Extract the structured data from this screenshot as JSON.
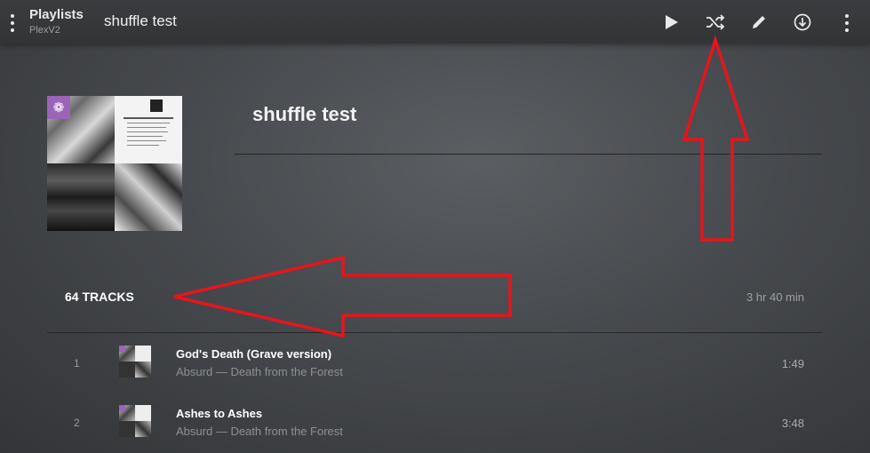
{
  "topbar": {
    "section_title": "Playlists",
    "server_name": "PlexV2",
    "title": "shuffle test",
    "actions": [
      "play-icon",
      "shuffle-icon",
      "edit-icon",
      "download-icon",
      "more-icon"
    ]
  },
  "playlist": {
    "title": "shuffle test",
    "tracks_count": "64 TRACKS",
    "duration": "3 hr 40 min"
  },
  "tracks": [
    {
      "num": "1",
      "title": "God's Death (Grave version)",
      "artist": "Absurd",
      "album": "Death from the Forest",
      "sep": " — ",
      "duration": "1:49"
    },
    {
      "num": "2",
      "title": "Ashes to Ashes",
      "artist": "Absurd",
      "album": "Death from the Forest",
      "sep": " — ",
      "duration": "3:48"
    }
  ],
  "annotations": {
    "arrow_color": "#e8141c"
  },
  "colors": {
    "accent": "#9a64b8"
  }
}
